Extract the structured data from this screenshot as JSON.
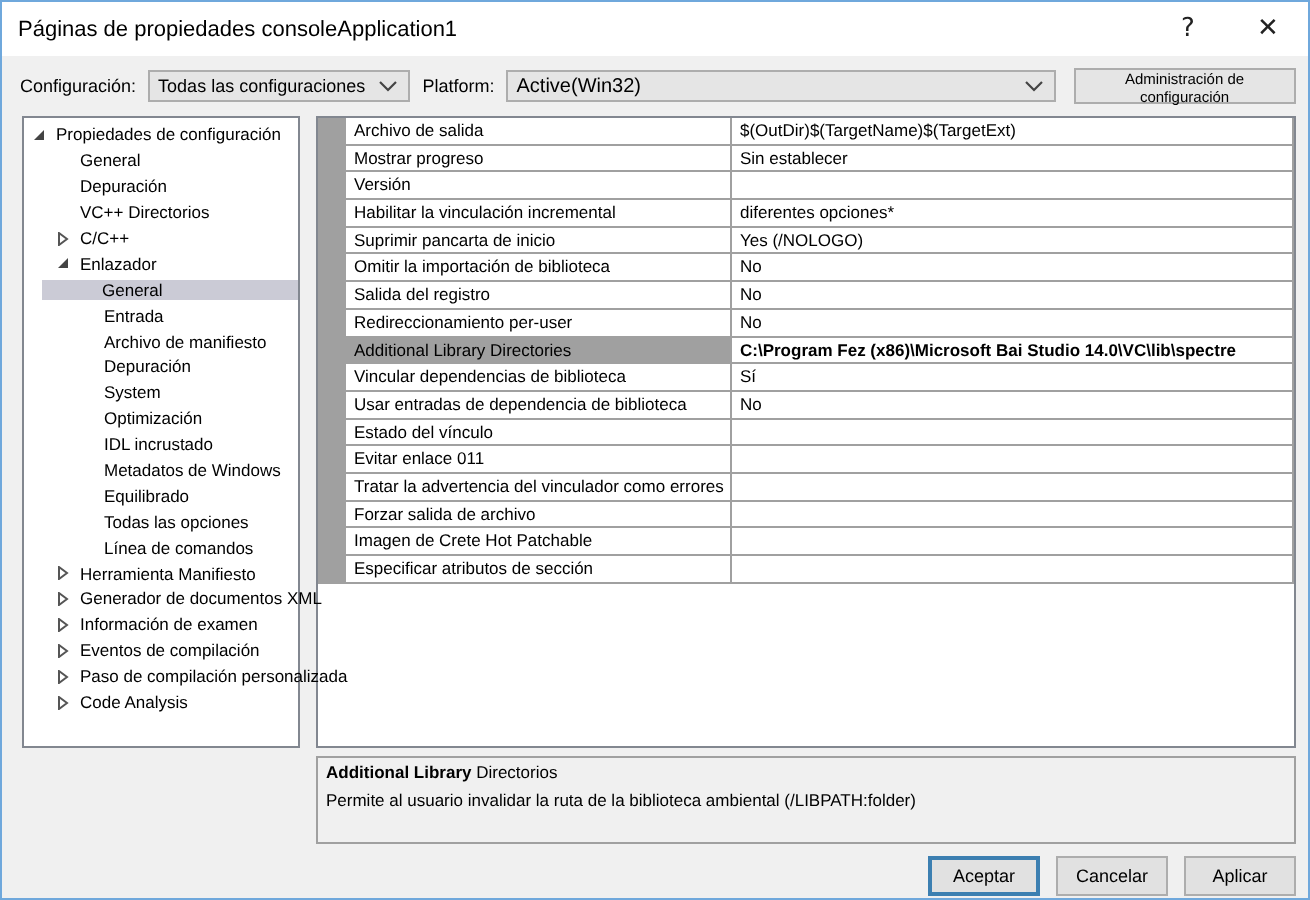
{
  "window": {
    "title": "Páginas de propiedades consoleApplication1",
    "controls": [
      "?",
      "✕"
    ]
  },
  "toolbar": {
    "configuration_label": "Configuración:",
    "configuration_value": "Todas las configuraciones",
    "platform_label": "Platform:",
    "platform_value": "Active(Win32)",
    "manager_button": "Administración de configuración"
  },
  "tree": [
    {
      "label": "Propiedades de configuración",
      "expanded": true,
      "selected": false,
      "children": [
        {
          "label": "General",
          "selected": false
        },
        {
          "label": "Depuración",
          "selected": false
        },
        {
          "label": "VC++ Directorios",
          "selected": false
        },
        {
          "label": "C/C++",
          "expanded": false,
          "selected": false
        },
        {
          "label": "Enlazador",
          "expanded": true,
          "selected": false,
          "children": [
            {
              "label": "General",
              "selected": true
            },
            {
              "label": "Entrada",
              "selected": false
            },
            {
              "label": "Archivo de manifiesto",
              "selected": false
            },
            {
              "label": "Depuración",
              "selected": false
            },
            {
              "label": "System",
              "selected": false
            },
            {
              "label": "Optimización",
              "selected": false
            },
            {
              "label": "IDL incrustado",
              "selected": false
            },
            {
              "label": "Metadatos de Windows",
              "selected": false
            },
            {
              "label": "Equilibrado",
              "selected": false
            },
            {
              "label": "Todas las opciones",
              "selected": false
            },
            {
              "label": "Línea de comandos",
              "selected": false
            }
          ]
        },
        {
          "label": "Herramienta Manifiesto",
          "expanded": false,
          "selected": false
        },
        {
          "label": "Generador de documentos XML",
          "expanded": false,
          "selected": false
        },
        {
          "label": "Información de examen",
          "expanded": false,
          "selected": false
        },
        {
          "label": "Eventos de compilación",
          "expanded": false,
          "selected": false
        },
        {
          "label": "Paso de compilación personalizada",
          "expanded": false,
          "selected": false
        },
        {
          "label": "Code Analysis",
          "expanded": false,
          "selected": false
        }
      ]
    }
  ],
  "properties": [
    {
      "name": "Archivo de salida",
      "value": "$(OutDir)$(TargetName)$(TargetExt)",
      "selected": false
    },
    {
      "name": "Mostrar progreso",
      "value": "Sin establecer",
      "selected": false
    },
    {
      "name": "Versión",
      "selected": false
    },
    {
      "name": "Habilitar la vinculación incremental",
      "value": "diferentes opciones*",
      "selected": false
    },
    {
      "name": "Suprimir pancarta de inicio",
      "value": "Yes (/NOLOGO)",
      "selected": false
    },
    {
      "name": "Omitir la importación de biblioteca",
      "value": "No",
      "selected": false
    },
    {
      "name": "Salida del registro",
      "value": "No",
      "selected": false
    },
    {
      "name": "Redireccionamiento per-user",
      "value": "No",
      "selected": false
    },
    {
      "name": "Additional Library Directories",
      "value": "C:\\Program Fez (x86)\\Microsoft Bai Studio 14.0\\VC\\lib\\spectre",
      "selected": true
    },
    {
      "name": "Vincular dependencias de biblioteca",
      "value": "Sí",
      "selected": false
    },
    {
      "name": "Usar entradas de dependencia de biblioteca",
      "value": "No",
      "selected": false
    },
    {
      "name": "Estado del vínculo",
      "selected": false
    },
    {
      "name": "Evitar enlace 011",
      "selected": false
    },
    {
      "name": "Tratar la advertencia del vinculador como errores",
      "selected": false
    },
    {
      "name": "Forzar salida de archivo",
      "selected": false
    },
    {
      "name": "Imagen de Crete Hot Patchable",
      "selected": false
    },
    {
      "name": "Especificar atributos de sección",
      "selected": false
    }
  ],
  "description": {
    "title": "**Additional Library** Directorios",
    "text": "Permite al usuario invalidar la ruta de la biblioteca ambiental (/LIBPATH:folder)"
  },
  "buttons": [
    "Aceptar",
    "Cancelar",
    "Aplicar"
  ]
}
